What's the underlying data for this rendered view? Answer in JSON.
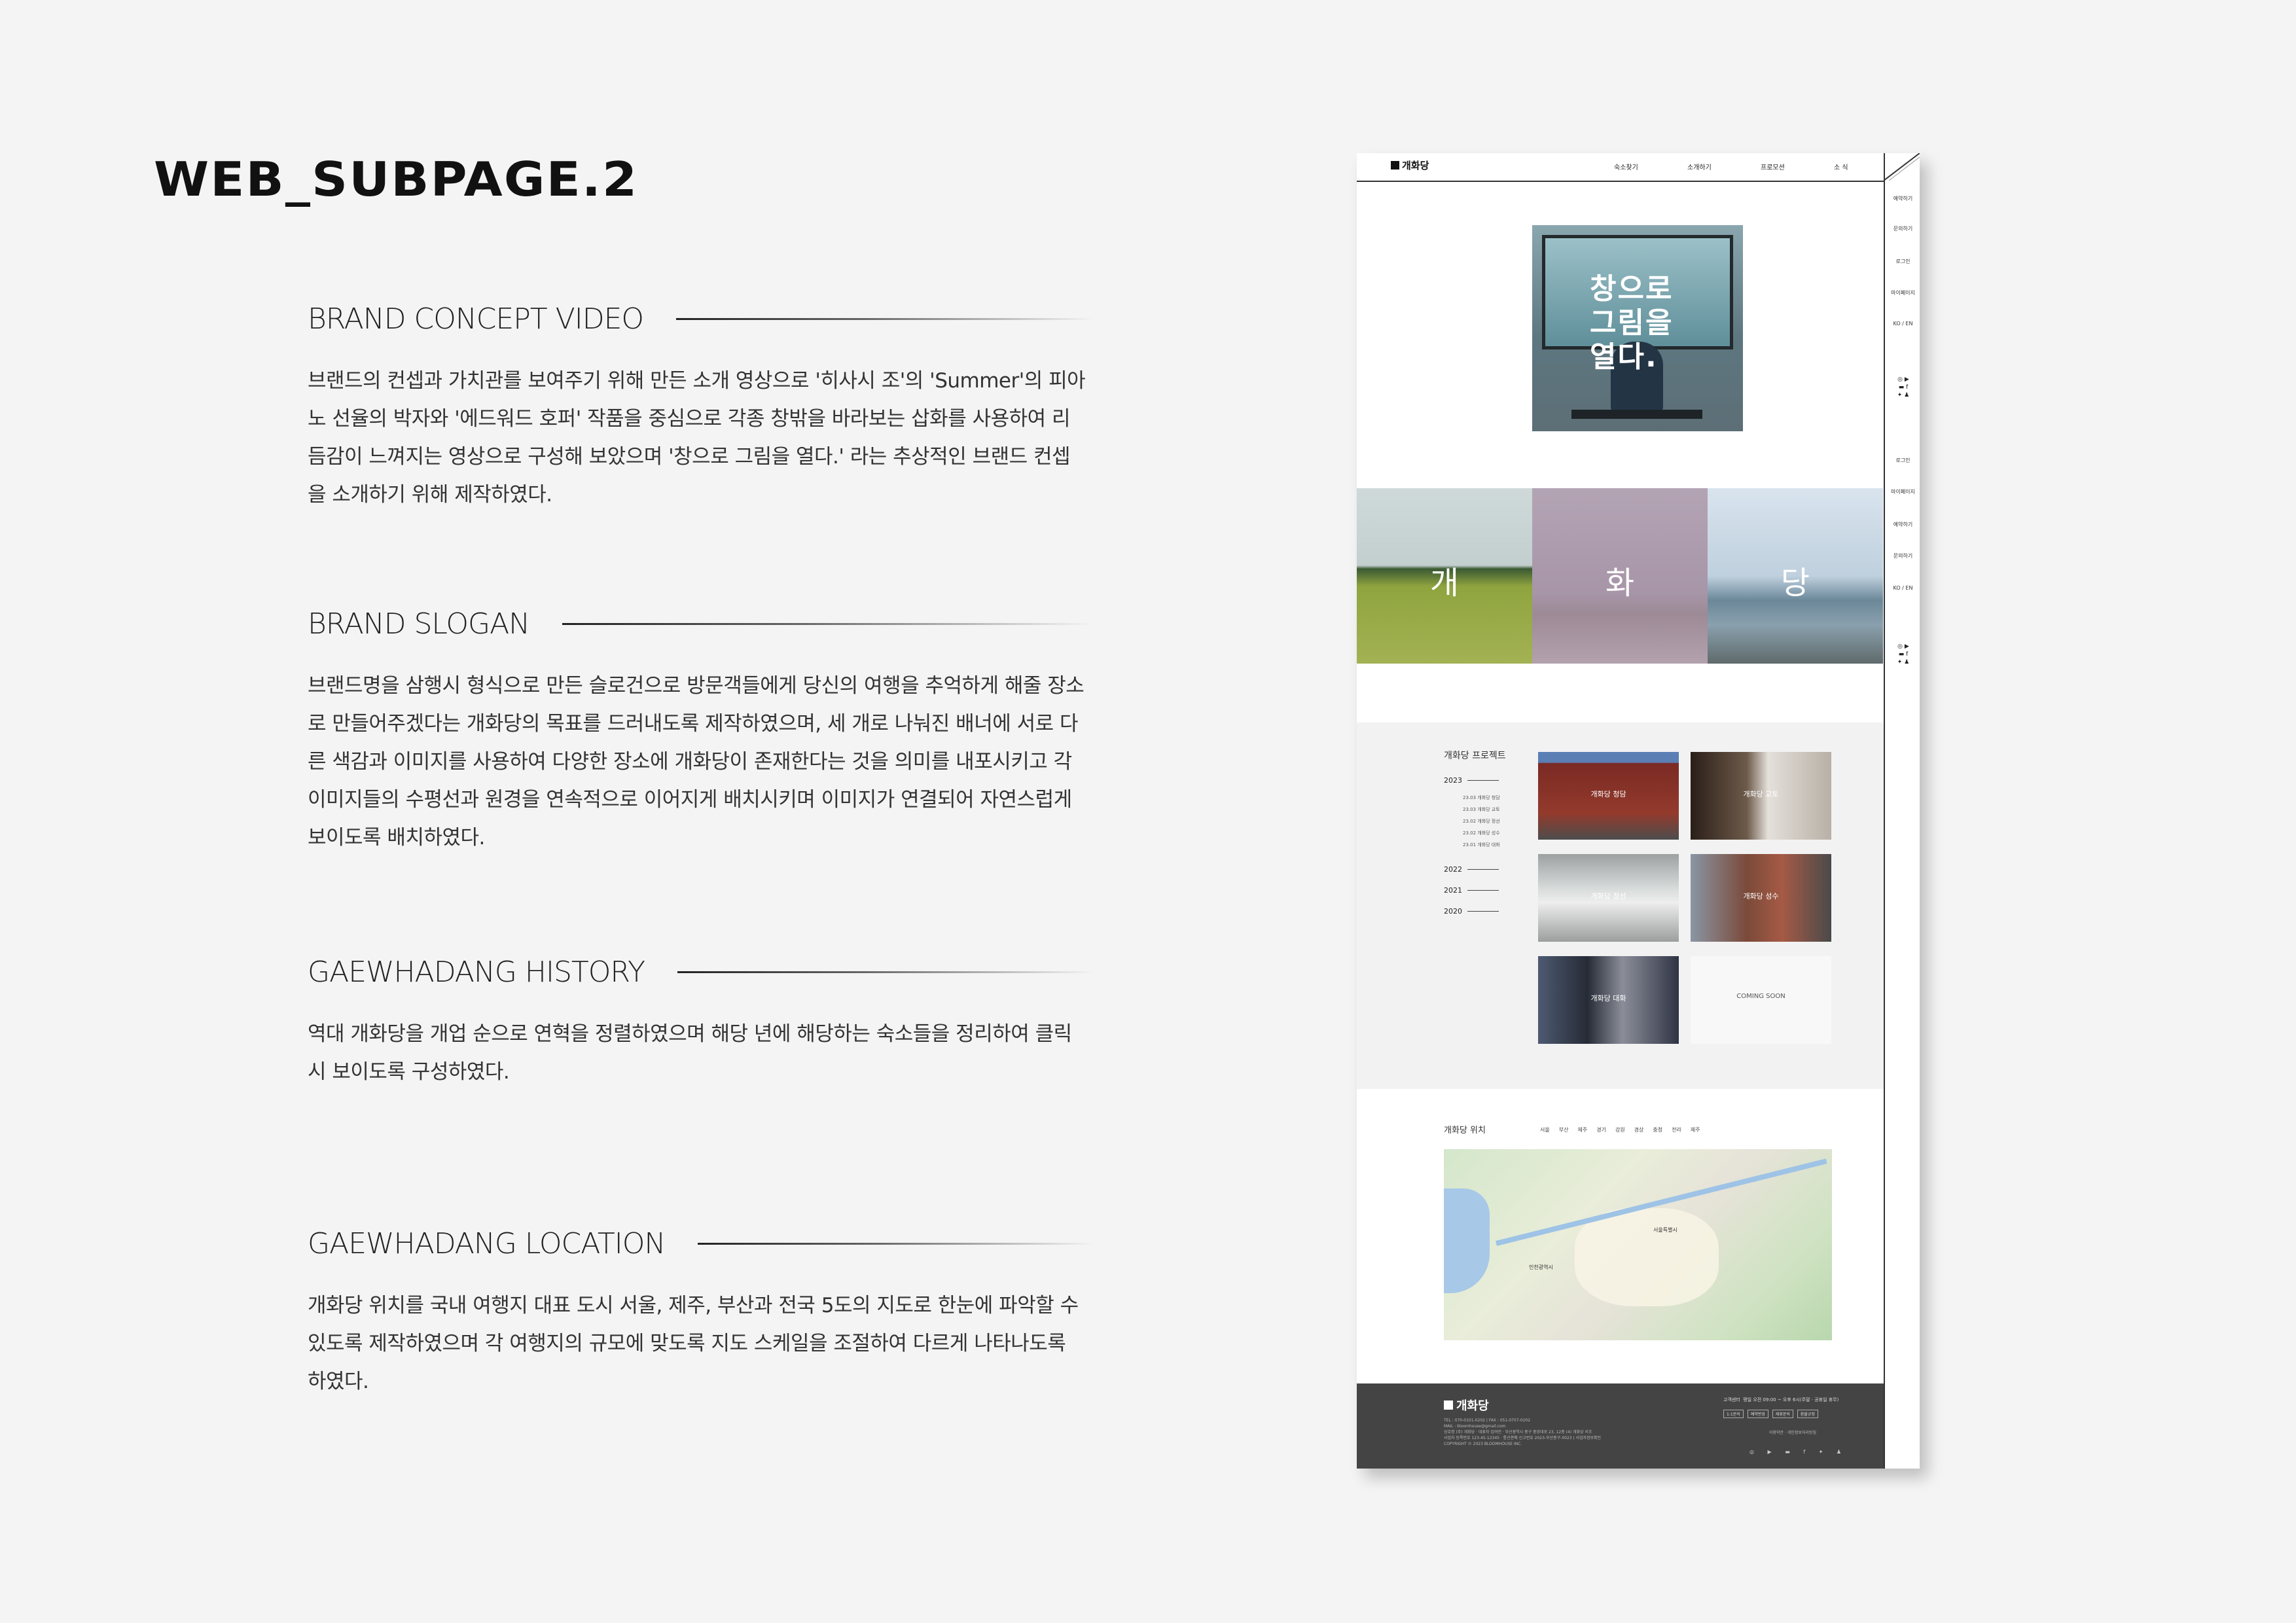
{
  "page_title": "WEB_SUBPAGE.2",
  "sections": [
    {
      "title": "BRAND CONCEPT VIDEO",
      "body": "브랜드의 컨셉과 가치관를 보여주기 위해 만든 소개 영상으로 '히사시 조'의 'Summer'의 피아노 선율의 박자와 '에드워드 호퍼' 작품을 중심으로 각종 창밖을 바라보는 삽화를 사용하여 리듬감이 느껴지는 영상으로 구성해 보았으며 '창으로 그림을 열다.' 라는 추상적인 브랜드 컨셉을 소개하기 위해 제작하였다."
    },
    {
      "title": "BRAND SLOGAN",
      "body": "브랜드명을 삼행시 형식으로 만든 슬로건으로 방문객들에게 당신의 여행을 추억하게 해줄 장소로 만들어주겠다는 개화당의 목표를 드러내도록 제작하였으며, 세 개로 나눠진 배너에 서로 다른 색감과 이미지를 사용하여 다양한 장소에 개화당이 존재한다는 것을 의미를 내포시키고 각 이미지들의 수평선과 원경을 연속적으로 이어지게 배치시키며 이미지가 연결되어 자연스럽게 보이도록 배치하였다."
    },
    {
      "title": "GAEWHADANG HISTORY",
      "body": "역대 개화당을 개업 순으로 연혁을 정렬하였으며 해당 년에 해당하는 숙소들을 정리하여 클릭시 보이도록 구성하였다."
    },
    {
      "title": "GAEWHADANG LOCATION",
      "body": "개화당 위치를 국내 여행지 대표 도시 서울, 제주, 부산과 전국 5도의 지도로 한눈에 파악할 수 있도록 제작하였으며 각 여행지의 규모에 맞도록 지도 스케일을 조절하여 다르게 나타나도록 하였다."
    }
  ],
  "mockup": {
    "logo": "개화당",
    "nav": [
      "숙소찾기",
      "소개하기",
      "프로모션",
      "소 식"
    ],
    "side_top": [
      "예약하기",
      "문의하기",
      "로그인",
      "마이페이지",
      "KO / EN"
    ],
    "side_bottom": [
      "로그인",
      "마이페이지",
      "예약하기",
      "문의하기",
      "KO / EN"
    ],
    "hero_text": "창으로\n그림을\n열다.",
    "banner": [
      "개",
      "화",
      "당"
    ],
    "project": {
      "title": "개화당 프로젝트",
      "years": [
        "2023",
        "2022",
        "2021",
        "2020"
      ],
      "subs_2023": [
        "23.03 개화당 청담",
        "23.03 개화당 교토",
        "23.02 개화당 정선",
        "23.02 개화당 성수",
        "23.01 개화당 대화"
      ],
      "cards": [
        "개화당 청담",
        "개화당 교토",
        "개화당 정선",
        "개화당 성수",
        "개화당 대화",
        "COMING SOON"
      ]
    },
    "location": {
      "title": "개화당 위치",
      "regions": [
        "서울",
        "부산",
        "제주",
        "경기",
        "강원",
        "경상",
        "충청",
        "전라",
        "제주"
      ],
      "map_labels": [
        "서울특별시",
        "인천광역시"
      ]
    },
    "footer": {
      "logo": "개화당",
      "info": [
        "TEL : 070-0101-0202  |  FAX : 051-0707-0202",
        "MAIL : bloomhouse@gmail.com",
        "상호명 (주) 개화당 · 대표자 임여진 · 부산광역시 중구 중앙대로 23, 12층 (4) 개화당 리조",
        "사업자 등록번호 123-45-12345 · 통신판매 신고번호 2023-부산중구-0023 | 사업자정보확인",
        "COPYRIGHT © 2023 BLOOMHOUSE INC."
      ],
      "cs": "고객센터",
      "cs_hours": "평일 오전 09:00 ~ 오후 6시(주말 · 공휴일 휴무)",
      "buttons": [
        "1:1문의",
        "예약변경",
        "제휴문의",
        "환불규정"
      ],
      "links": "이용약관 · 개인정보처리방침",
      "social": "◎ ▶ ▬ f ✦ ♟"
    }
  }
}
